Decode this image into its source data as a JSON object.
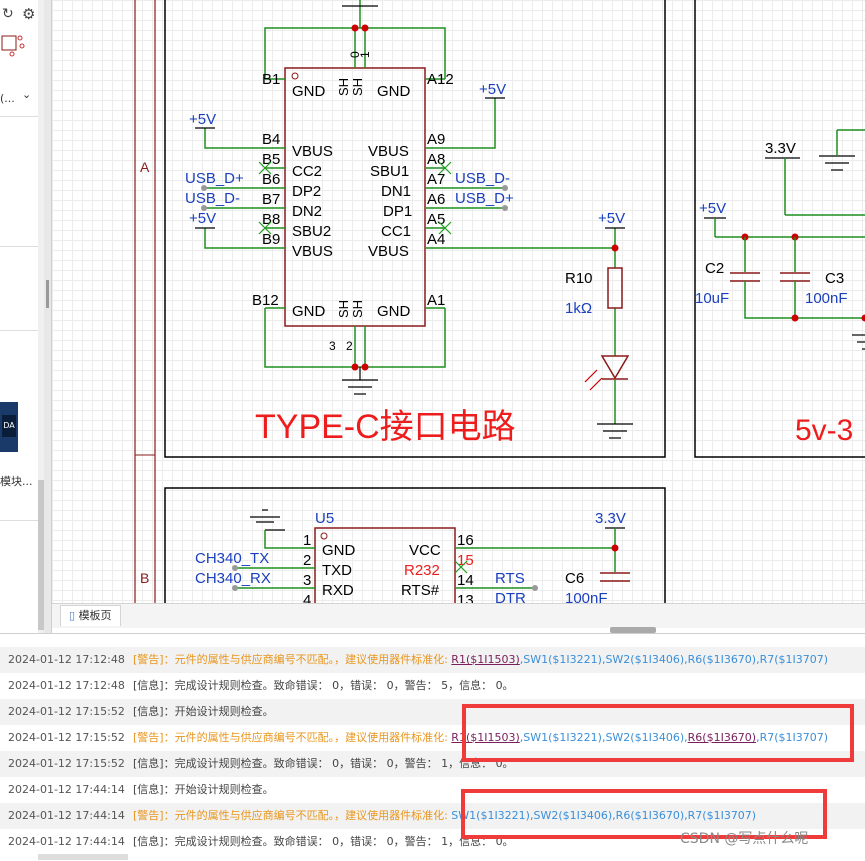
{
  "left_panel": {
    "item_text": "(...",
    "item_caret": "⌄",
    "thumb_text": "DA",
    "module_label": "模块...",
    "icons": [
      "refresh-icon",
      "settings-icon"
    ]
  },
  "schematic": {
    "section_labels": [
      "A",
      "B"
    ],
    "usb_block": {
      "title": "TYPE-C接口电路",
      "top_pins": [
        "0",
        "1"
      ],
      "bottom_pins": [
        "3",
        "2"
      ],
      "left_pin_numbers": [
        "B1",
        "B4",
        "B5",
        "B6",
        "B7",
        "B8",
        "B9",
        "B12"
      ],
      "left_pin_names": [
        "GND",
        "VBUS",
        "CC2",
        "DP2",
        "DN2",
        "SBU2",
        "VBUS",
        "GND"
      ],
      "right_pin_numbers": [
        "A12",
        "A9",
        "A8",
        "A7",
        "A6",
        "A5",
        "A4",
        "A1"
      ],
      "right_pin_names": [
        "GND",
        "VBUS",
        "SBU1",
        "DN1",
        "DP1",
        "CC1",
        "VBUS",
        "GND"
      ],
      "shield_top": [
        "SH",
        "SH"
      ],
      "shield_bottom": [
        "SH",
        "SH"
      ],
      "left_nets": [
        "+5V",
        "USB_D+",
        "USB_D-",
        "+5V"
      ],
      "right_nets": [
        "+5V",
        "USB_D-",
        "USB_D+",
        "+5V"
      ],
      "resistor_ref": "R10",
      "resistor_val": "1kΩ"
    },
    "reg_block": {
      "title": "5v-3",
      "net_33": "3.3V",
      "net_5v": "+5V",
      "c2_ref": "C2",
      "c2_val": "10uF",
      "c3_ref": "C3",
      "c3_val": "100nF"
    },
    "ch340_block": {
      "ref": "U5",
      "pin_numbers_left": [
        "1",
        "2",
        "3",
        "4"
      ],
      "pin_names_left": [
        "GND",
        "TXD",
        "RXD"
      ],
      "pin_numbers_right": [
        "16",
        "15",
        "14",
        "13"
      ],
      "pin_names_right": [
        "VCC",
        "R232",
        "RTS#"
      ],
      "nets_left": [
        "CH340_TX",
        "CH340_RX"
      ],
      "nets_right": [
        "RTS",
        "DTR"
      ],
      "net_33": "3.3V",
      "c6_ref": "C6",
      "c6_val": "100nF"
    }
  },
  "tab_bar": {
    "tab_label": "模板页"
  },
  "log": {
    "rows": [
      {
        "ts": "2024-01-12 17:12:48",
        "type": "warn",
        "text": "[警告]：元件的属性与供应商编号不匹配。，建议使用器件标准化: ",
        "links": [
          "R1($1I1503)",
          "SW1($1I3221)",
          "SW2($1I3406)",
          "R6($1I3670)",
          "R7($1I3707)"
        ],
        "underline": [
          0
        ]
      },
      {
        "ts": "2024-01-12 17:12:48",
        "type": "info",
        "text": "[信息]：完成设计规则检查。致命错误： 0，错误： 0，警告： 5，信息： 0。"
      },
      {
        "ts": "2024-01-12 17:15:52",
        "type": "info",
        "text": "[信息]：开始设计规则检查。"
      },
      {
        "ts": "2024-01-12 17:15:52",
        "type": "warn",
        "text": "[警告]：元件的属性与供应商编号不匹配。，建议使用器件标准化: ",
        "links": [
          "R1($1I1503)",
          "SW1($1I3221)",
          "SW2($1I3406)",
          "R6($1I3670)",
          "R7($1I3707)"
        ],
        "underline": [
          0,
          3
        ]
      },
      {
        "ts": "2024-01-12 17:15:52",
        "type": "info",
        "text": "[信息]：完成设计规则检查。致命错误： 0，错误： 0，警告： 1，信息： 0。"
      },
      {
        "ts": "2024-01-12 17:44:14",
        "type": "info",
        "text": "[信息]：开始设计规则检查。"
      },
      {
        "ts": "2024-01-12 17:44:14",
        "type": "warn",
        "text": "[警告]：元件的属性与供应商编号不匹配。，建议使用器件标准化: ",
        "links": [
          "SW1($1I3221)",
          "SW2($1I3406)",
          "R6($1I3670)",
          "R7($1I3707)"
        ],
        "underline": []
      },
      {
        "ts": "2024-01-12 17:44:14",
        "type": "info",
        "text": "[信息]：完成设计规则检查。致命错误： 0，错误： 0，警告： 1，信息： 0。"
      }
    ]
  },
  "watermark": "CSDN @写点什么呢",
  "colors": {
    "wire": "#1f8f1f",
    "component": "#8b1a1a",
    "net": "#1a3fbf",
    "title": "#ee1d1d",
    "highlight": "#f03b3b"
  }
}
